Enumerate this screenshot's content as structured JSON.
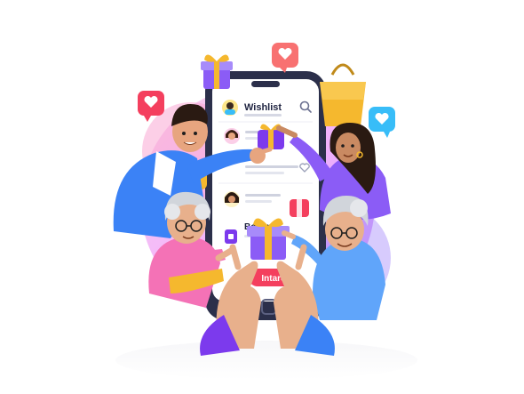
{
  "phone": {
    "header_title": "Wishlist",
    "item_label": "Bonanza",
    "cta_label": "Intare"
  },
  "colors": {
    "primary_purple": "#7c3aed",
    "pink": "#ec4899",
    "blue": "#38bdf8",
    "gold": "#f5b82e",
    "gradient_blob": "#c084fc"
  },
  "icons": {
    "header_avatar": "avatar-icon",
    "header_search": "search-icon",
    "row_heart": "heart-icon",
    "floating_heart": "heart-icon",
    "gift": "gift-icon",
    "shopping_bag": "shopping-bag-icon"
  }
}
